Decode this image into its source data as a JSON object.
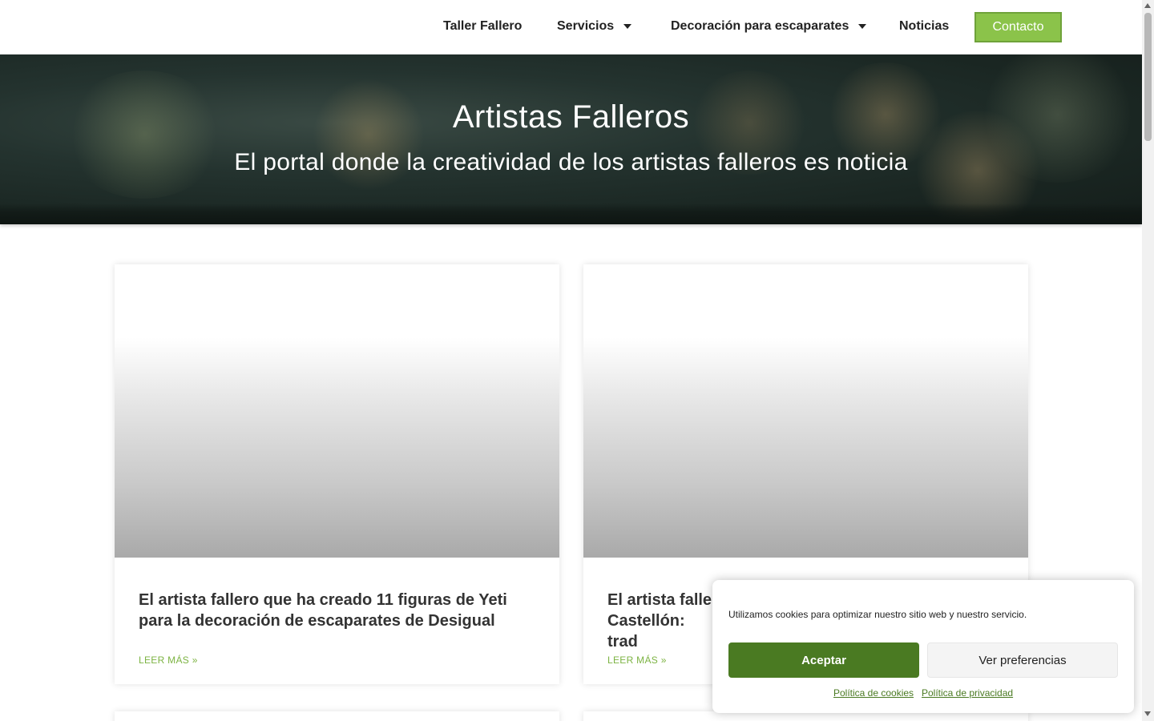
{
  "nav": {
    "items": [
      {
        "label": "Taller Fallero",
        "has_dropdown": false
      },
      {
        "label": "Servicios",
        "has_dropdown": true
      },
      {
        "label": "Decoración para escaparates",
        "has_dropdown": true
      },
      {
        "label": "Noticias",
        "has_dropdown": false
      }
    ],
    "contact_label": "Contacto"
  },
  "hero": {
    "title": "Artistas Falleros",
    "subtitle": "El portal donde la creatividad de los artistas falleros es noticia"
  },
  "posts": [
    {
      "title": "El artista fallero que ha creado 11 figuras de Yeti para la decoración de escaparates de Desigual",
      "read_more": "LEER MÁS »"
    },
    {
      "title": "El artista faller Castellón: trad",
      "read_more": "LEER MÁS »"
    }
  ],
  "cookie": {
    "message": "Utilizamos cookies para optimizar nuestro sitio web y nuestro servicio.",
    "accept_label": "Aceptar",
    "preferences_label": "Ver preferencias",
    "cookie_policy_label": "Política de cookies",
    "privacy_policy_label": "Política de privacidad"
  },
  "colors": {
    "accent": "#8bc34a",
    "accept_button": "#4a7a22",
    "link": "#7cb342",
    "hero_bg": "#1e2b27"
  }
}
